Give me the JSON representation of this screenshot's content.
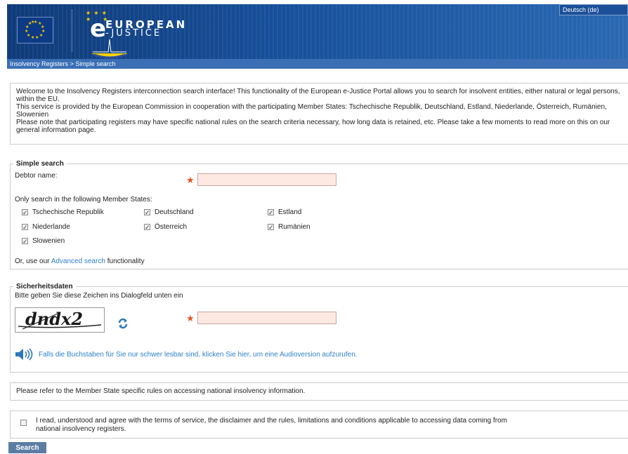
{
  "header": {
    "language": "Deutsch (de)",
    "logo_e": "e",
    "logo_european": "EUROPEAN",
    "logo_justice": "-JUSTICE",
    "breadcrumb": [
      "Insolvency Registers",
      "Simple search"
    ],
    "breadcrumb_sep": ">"
  },
  "intro": {
    "line1": "Welcome to the Insolvency Registers interconnection search interface! This functionality of the European e-Justice Portal allows you to search for insolvent entities, either natural or legal persons, within the EU.",
    "line2": "This service is provided by the European Commission in cooperation with the participating Member States: Tschechische Republik, Deutschland, Estland, Niederlande, Österreich, Rumänien, Slowenien",
    "line3": "Please note that participating registers may have specific national rules on the search criteria necessary, how long data is retained, etc. Please take a few moments to read more on this on our general information page."
  },
  "simple_search": {
    "legend": "Simple search",
    "debtor_label": "Debtor name:",
    "required_mark": "★",
    "member_states_label": "Only search in the following Member States:",
    "states": [
      {
        "name": "Tschechische Republik",
        "checked": true
      },
      {
        "name": "Deutschland",
        "checked": true
      },
      {
        "name": "Estland",
        "checked": true
      },
      {
        "name": "Niederlande",
        "checked": true
      },
      {
        "name": "Österreich",
        "checked": true
      },
      {
        "name": "Rumänien",
        "checked": true
      },
      {
        "name": "Slowenien",
        "checked": true
      }
    ],
    "check_mark": "✓",
    "advanced_prefix": "Or, use our",
    "advanced_link": "Advanced search",
    "advanced_suffix": "functionality"
  },
  "security": {
    "legend": "Sicherheitsdaten",
    "instruction": "Bitte geben Sie diese Zeichen ins Dialogfeld unten ein",
    "captcha_text": "dndx2",
    "required_mark": "★",
    "audio_text": "Falls die Buchstaben für Sie nur schwer lesbar sind, klicken Sie hier, um eine Audioversion aufzurufen."
  },
  "refer_text": "Please refer to the Member State specific rules on accessing national insolvency information.",
  "agree_text_1": "I read, understood and agree with the terms of service, the disclaimer and the rules, limitations and conditions applicable to accessing data coming from",
  "agree_text_2": "national insolvency registers.",
  "search_button": "Search",
  "colors": {
    "header": "#17509b",
    "breadcrumb_bar": "#3a6fb5",
    "required_field": "#fde8e2",
    "link": "#2e82c8",
    "search_button": "#5c7da3"
  }
}
